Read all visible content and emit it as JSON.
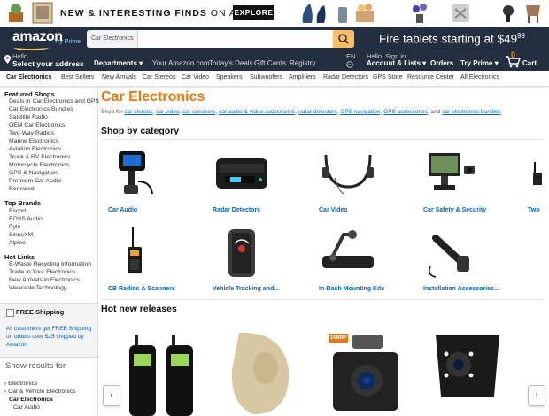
{
  "promo": {
    "headline_bold": "NEW & INTERESTING FINDS",
    "headline_light": " ON AMAZON",
    "explore_label": "EXPLORE"
  },
  "header": {
    "logo": "amazon",
    "try_prime": "Try Prime",
    "search_category": "Car Electronics",
    "search_placeholder": "",
    "fire_ad": "Fire tablets starting at $49",
    "fire_cents": "99",
    "hello": "Hello",
    "select_address": "Select your address",
    "departments": "Departments",
    "links": [
      "Your Amazon.com",
      "Today's Deals",
      "Gift Cards",
      "Registry"
    ],
    "lang": "EN",
    "signin_hello": "Hello. Sign in",
    "account": "Account & Lists",
    "orders": "Orders",
    "try_prime2": "Try Prime",
    "cart_count": "0",
    "cart": "Cart"
  },
  "subnav": [
    "Car Electronics",
    "Best Sellers",
    "New Arrivals",
    "Car Stereos",
    "Car Video",
    "Speakers",
    "Subwoofers",
    "Amplifiers",
    "Radar Detectors",
    "GPS Store",
    "Resource Center",
    "All Electronics"
  ],
  "sidebar": {
    "featured_h": "Featured Shops",
    "featured": [
      "Deals in Car Electronics and GPS",
      "Car Electronics Bundles",
      "Satellite Radio",
      "OEM Car Electronics",
      "Two-Way Radios",
      "Marine Electronics",
      "Aviation Electronics",
      "Truck & RV Electronics",
      "Motorcycle Electronics",
      "GPS & Navigation",
      "Premium Car Audio",
      "Renewed"
    ],
    "brands_h": "Top Brands",
    "brands": [
      "Escort",
      "BOSS Audio",
      "Pyle",
      "SiriusXM",
      "Alpine"
    ],
    "hot_h": "Hot Links",
    "hot": [
      "E-Waste Recycling Information",
      "Trade in Your Electronics",
      "New Arrivals in Electronics",
      "Wearable Technology"
    ],
    "free_shipping": "FREE Shipping",
    "free_note": "All customers get FREE Shipping on orders over $25 shipped by Amazon",
    "show_results": "Show results for",
    "results": [
      "Electronics",
      "Car & Vehicle Electronics",
      "Car Electronics",
      "Car Audio"
    ]
  },
  "main": {
    "title": "Car Electronics",
    "shop_for_prefix": "Shop for",
    "shop_for_links": [
      "car stereos",
      "car video",
      "car speakers",
      "car audio & video accessories",
      "radar detectors",
      "GPS navigation",
      "GPS accessories",
      "car electronics bundles"
    ],
    "shop_for_and": "and",
    "shop_by_category": "Shop by category",
    "categories": [
      "Car Audio",
      "Radar Detectors",
      "Car Video",
      "Car Safety & Security",
      "Two",
      "CB Radios & Scanners",
      "Vehicle Tracking and...",
      "In-Dash Mounting Kits",
      "Installation Accessories..."
    ],
    "hot_new_releases": "Hot new releases",
    "badge_1080p": "1080P"
  },
  "colors": {
    "nav_bg": "#232f3e",
    "accent": "#e47911",
    "link": "#0066c0",
    "search_btn": "#febd69"
  }
}
